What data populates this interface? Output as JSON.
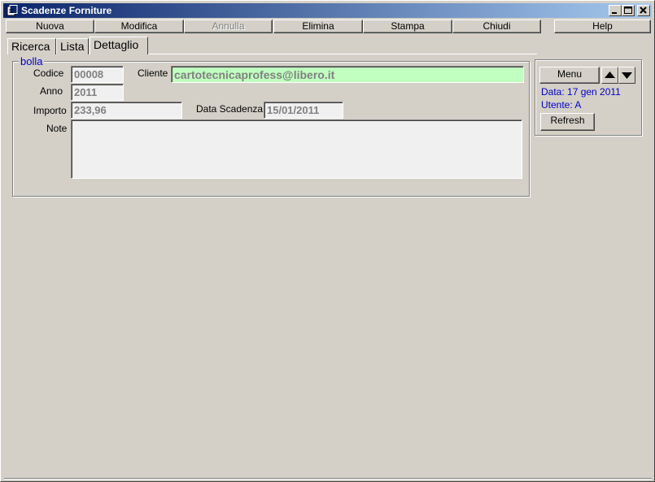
{
  "window": {
    "title": "Scadenze Forniture"
  },
  "toolbar": {
    "nuova": "Nuova",
    "modifica": "Modifica",
    "annulla": "Annulla",
    "elimina": "Elimina",
    "stampa": "Stampa",
    "chiudi": "Chiudi",
    "help": "Help"
  },
  "tabs": {
    "ricerca": "Ricerca",
    "lista": "Lista",
    "dettaglio": "Dettaglio"
  },
  "form": {
    "group_label": "bolla",
    "codice_label": "Codice",
    "codice_value": "00008",
    "cliente_label": "Cliente",
    "cliente_value": "cartotecnicaprofess@libero.it",
    "anno_label": "Anno",
    "anno_value": "2011",
    "importo_label": "Importo",
    "importo_value": "233,96",
    "scadenza_label": "Data Scadenza",
    "scadenza_value": "15/01/2011",
    "note_label": "Note",
    "note_value": ""
  },
  "panel": {
    "menu_label": "Menu",
    "data_text": "Data: 17 gen 2011",
    "utente_text": "Utente: A",
    "refresh_label": "Refresh"
  },
  "colors": {
    "title_start": "#0a246a",
    "title_end": "#a6caf0",
    "info_blue": "#0000c8",
    "field_green": "#c0ffc0",
    "face": "#d4d0c8"
  }
}
